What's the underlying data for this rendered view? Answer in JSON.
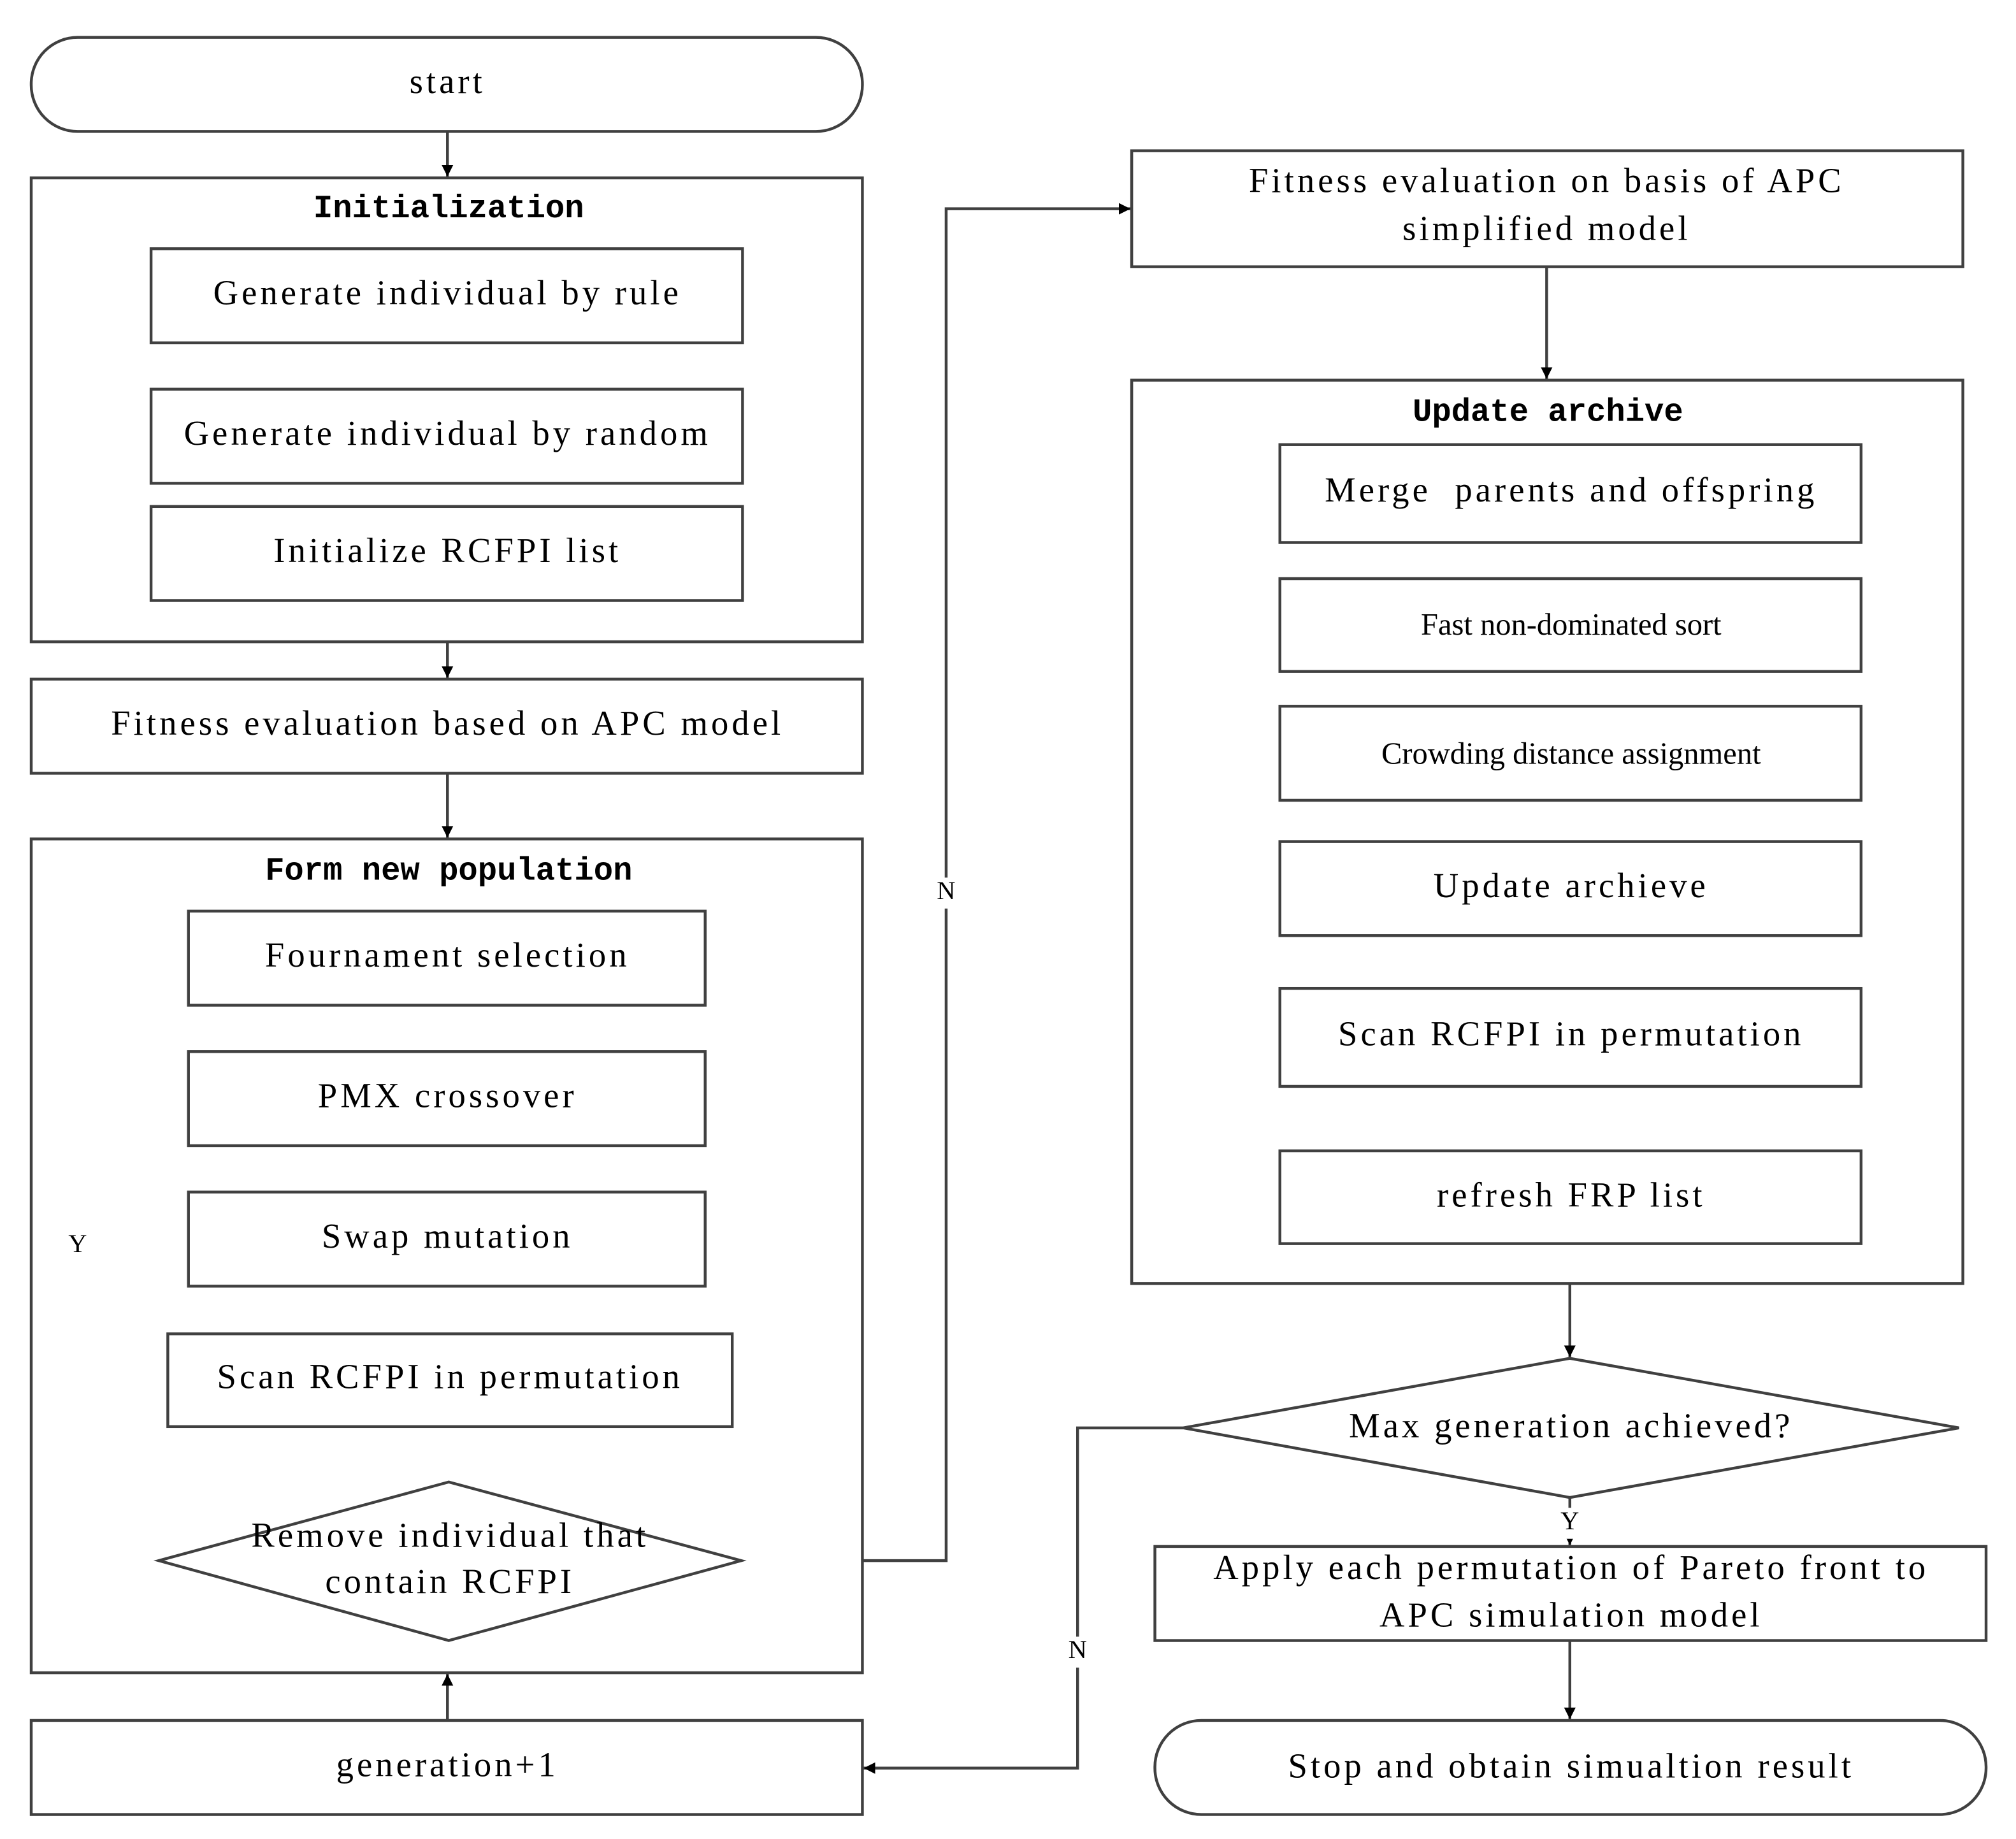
{
  "start": "start",
  "initialization": {
    "title": "Initialization",
    "steps": [
      "Generate individual by rule",
      "Generate individual by random",
      "Initialize RCFPI list"
    ]
  },
  "fitness_apc": "Fitness evaluation based on APC model",
  "form_population": {
    "title": "Form new population",
    "steps": [
      "Fournament selection",
      "PMX crossover",
      "Swap mutation",
      "Scan RCFPI in permutation"
    ],
    "decision": [
      "Remove individual that",
      "contain RCFPI"
    ]
  },
  "generation": "generation+1",
  "fitness_simplified": [
    "Fitness evaluation on basis of APC",
    "simplified model"
  ],
  "update_archive": {
    "title": "Update archive",
    "steps": [
      "Merge  parents and offspring",
      "Fast non-dominated sort",
      "Crowding distance assignment",
      "Update archieve",
      "Scan RCFPI in permutation",
      "refresh FRP list"
    ]
  },
  "max_decision": "Max generation achieved?",
  "apply": [
    "Apply each permutation of Pareto front to",
    "APC simulation model"
  ],
  "stop": "Stop and obtain simualtion result",
  "labels": {
    "yes": "Y",
    "no": "N"
  }
}
